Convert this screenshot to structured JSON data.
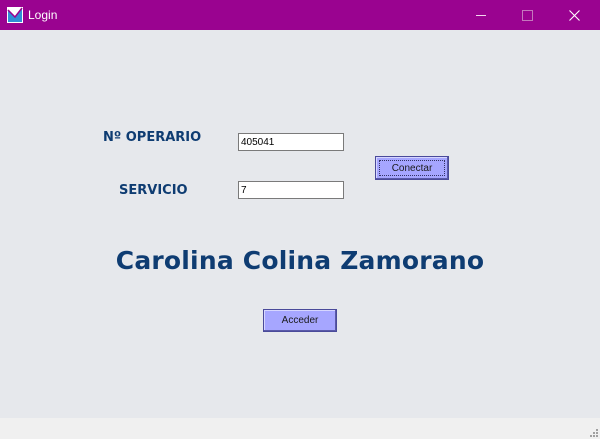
{
  "window": {
    "title": "Login",
    "controls": {
      "minimize": "minimize-icon",
      "maximize": "maximize-icon",
      "close": "close-icon"
    }
  },
  "form": {
    "operario_label": "Nº OPERARIO",
    "operario_value": "405041",
    "servicio_label": "SERVICIO",
    "servicio_value": "7",
    "conectar_label": "Conectar",
    "user_name": "Carolina Colina Zamorano",
    "acceder_label": "Acceder"
  },
  "colors": {
    "titlebar": "#9a0390",
    "background": "#e6e8ec",
    "label_text": "#0e3c72",
    "button": "#a6a6ff"
  }
}
